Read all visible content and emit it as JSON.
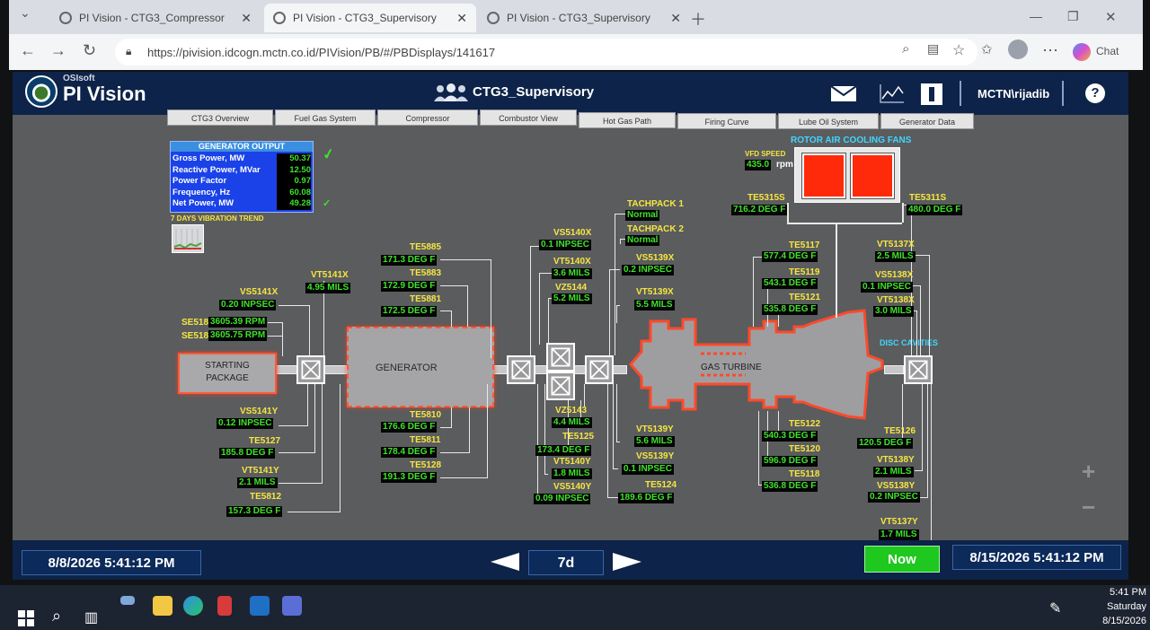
{
  "browser": {
    "tabs": [
      {
        "title": "PI Vision - CTG3_Compressor"
      },
      {
        "title": "PI Vision - CTG3_Supervisory"
      },
      {
        "title": "PI Vision - CTG3_Supervisory"
      }
    ],
    "url": "https://pivision.idcogn.mctn.co.id/PIVision/PB/#/PBDisplays/141617",
    "chat_label": "Chat"
  },
  "app": {
    "brand_small": "OSIsoft",
    "brand": "PI Vision",
    "display_title": "CTG3_Supervisory",
    "user": "MCTN\\rijadib",
    "help": "?"
  },
  "nav_tabs": [
    "CTG3 Overview",
    "Fuel Gas System",
    "Compressor",
    "Combustor View",
    "Hot Gas Path",
    "Firing Curve",
    "Lube Oil System",
    "Generator Data"
  ],
  "generator_output": {
    "title": "GENERATOR OUTPUT",
    "rows": [
      {
        "label": "Gross Power, MW",
        "value": "50.37"
      },
      {
        "label": "Reactive Power, MVar",
        "value": "12.50"
      },
      {
        "label": "Power Factor",
        "value": "0.97"
      },
      {
        "label": "Frequency, Hz",
        "value": "60.08"
      },
      {
        "label": "Net Power, MW",
        "value": "49.28"
      }
    ],
    "trend_label": "7 DAYS VIBRATION TREND"
  },
  "equipment": {
    "starting_package": "STARTING\nPACKAGE",
    "generator": "GENERATOR",
    "gas_turbine": "GAS TURBINE",
    "rotor_fans": "ROTOR AIR COOLING FANS",
    "vfd_label": "VFD SPEED",
    "vfd_value": "435.0",
    "vfd_unit": "rpm",
    "disc_cavities": "DISC CAVITIES"
  },
  "tags": {
    "vt5141x": {
      "label": "VT5141X",
      "value": "4.95 MILS"
    },
    "vs5141x": {
      "label": "VS5141X",
      "value": "0.20 INPSEC"
    },
    "se51a": {
      "label": "SE518",
      "value": "3605.39 RPM"
    },
    "se51b": {
      "label": "SE518",
      "value": "3605.75 RPM"
    },
    "vs5141y": {
      "label": "VS5141Y",
      "value": "0.12 INPSEC"
    },
    "te5127": {
      "label": "TE5127",
      "value": "185.8 DEG F"
    },
    "vt5141y": {
      "label": "VT5141Y",
      "value": "2.1 MILS"
    },
    "te5812": {
      "label": "TE5812",
      "value": "157.3 DEG F"
    },
    "te5885": {
      "label": "TE5885",
      "value": "171.3 DEG F"
    },
    "te5883": {
      "label": "TE5883",
      "value": "172.9 DEG F"
    },
    "te5881": {
      "label": "TE5881",
      "value": "172.5 DEG F"
    },
    "te5810": {
      "label": "TE5810",
      "value": "176.6 DEG F"
    },
    "te5811": {
      "label": "TE5811",
      "value": "178.4 DEG F"
    },
    "te5128": {
      "label": "TE5128",
      "value": "191.3 DEG F"
    },
    "vs5140x": {
      "label": "VS5140X",
      "value": "0.1 INPSEC"
    },
    "vt5140x": {
      "label": "VT5140X",
      "value": "3.6 MILS"
    },
    "vz5144": {
      "label": "VZ5144",
      "value": "5.2 MILS"
    },
    "vz5143": {
      "label": "VZ5143",
      "value": "4.4 MILS"
    },
    "te5125": {
      "label": "TE5125",
      "value": "173.4 DEG F"
    },
    "vt5140y": {
      "label": "VT5140Y",
      "value": "1.8 MILS"
    },
    "vs5140y": {
      "label": "VS5140Y",
      "value": "0.09 INPSEC"
    },
    "tach1": {
      "label": "TACHPACK 1",
      "value": "Normal"
    },
    "tach2": {
      "label": "TACHPACK 2",
      "value": "Normal"
    },
    "vs5139x": {
      "label": "VS5139X",
      "value": "0.2 INPSEC"
    },
    "vt5139x": {
      "label": "VT5139X",
      "value": "5.5 MILS"
    },
    "vt5139y": {
      "label": "VT5139Y",
      "value": "5.6 MILS"
    },
    "vs5139y": {
      "label": "VS5139Y",
      "value": "0.1 INPSEC"
    },
    "te5124": {
      "label": "TE5124",
      "value": "189.6 DEG F"
    },
    "te5315s": {
      "label": "TE5315S",
      "value": "716.2 DEG F"
    },
    "te5311s": {
      "label": "TE5311S",
      "value": "480.0 DEG F"
    },
    "te5117": {
      "label": "TE5117",
      "value": "577.4 DEG F"
    },
    "te5119": {
      "label": "TE5119",
      "value": "543.1 DEG F"
    },
    "te5121": {
      "label": "TE5121",
      "value": "535.8 DEG F"
    },
    "te5122": {
      "label": "TE5122",
      "value": "540.3 DEG F"
    },
    "te5120": {
      "label": "TE5120",
      "value": "596.9 DEG F"
    },
    "te5118": {
      "label": "TE5118",
      "value": "536.8 DEG F"
    },
    "vt5137x": {
      "label": "VT5137X",
      "value": "2.5 MILS"
    },
    "vs5138x": {
      "label": "VS5138X",
      "value": "0.1 INPSEC"
    },
    "vt5138x": {
      "label": "VT5138X",
      "value": "3.0 MILS"
    },
    "te5126": {
      "label": "TE5126",
      "value": "120.5 DEG F"
    },
    "vt5138y": {
      "label": "VT5138Y",
      "value": "2.1 MILS"
    },
    "vs5138y": {
      "label": "VS5138Y",
      "value": "0.2 INPSEC"
    },
    "vt5137y": {
      "label": "VT5137Y",
      "value": "1.7 MILS"
    }
  },
  "timebar": {
    "start": "8/8/2026 5:41:12 PM",
    "duration": "7d",
    "now_label": "Now",
    "end": "8/15/2026 5:41:12 PM"
  },
  "taskbar": {
    "time": "5:41 PM",
    "day": "Saturday",
    "date": "8/15/2026"
  }
}
